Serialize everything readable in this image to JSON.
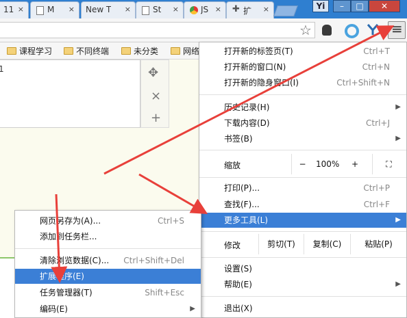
{
  "tabs": [
    {
      "title": "11",
      "close": "×"
    },
    {
      "title": "M",
      "close": "×"
    },
    {
      "title": "New T",
      "close": "×"
    },
    {
      "title": "St",
      "close": "×"
    },
    {
      "title": "JS",
      "close": "×"
    },
    {
      "title": "扩",
      "close": "×"
    }
  ],
  "window": {
    "user_badge": "Yi",
    "minimize": "–",
    "maximize": "□",
    "close": "✕"
  },
  "toolbar": {
    "star_icon": "☆",
    "menu_icon": "≡"
  },
  "bookmarks": [
    {
      "label": "课程学习"
    },
    {
      "label": "不同终端"
    },
    {
      "label": "未分类"
    },
    {
      "label": "网络"
    }
  ],
  "page": {
    "line_number": "1",
    "move_icon": "✥",
    "close_icon": "×",
    "add_icon": "+"
  },
  "main_menu": {
    "items": [
      {
        "label": "打开新的标签页(T)",
        "shortcut": "Ctrl+T"
      },
      {
        "label": "打开新的窗口(N)",
        "shortcut": "Ctrl+N"
      },
      {
        "label": "打开新的隐身窗口(I)",
        "shortcut": "Ctrl+Shift+N"
      },
      {
        "label": "历史记录(H)",
        "shortcut": "",
        "submenu": "▶"
      },
      {
        "label": "下载内容(D)",
        "shortcut": "Ctrl+J"
      },
      {
        "label": "书签(B)",
        "shortcut": "",
        "submenu": "▶"
      }
    ],
    "zoom": {
      "label": "缩放",
      "minus": "−",
      "value": "100%",
      "plus": "+",
      "fullscreen": "⛶"
    },
    "items2": [
      {
        "label": "打印(P)...",
        "shortcut": "Ctrl+P"
      },
      {
        "label": "查找(F)...",
        "shortcut": "Ctrl+F"
      },
      {
        "label": "更多工具(L)",
        "shortcut": "",
        "submenu": "▶"
      }
    ],
    "edit": {
      "label": "修改",
      "cut": "剪切(T)",
      "copy": "复制(C)",
      "paste": "粘贴(P)"
    },
    "items3": [
      {
        "label": "设置(S)",
        "shortcut": ""
      },
      {
        "label": "帮助(E)",
        "shortcut": "",
        "submenu": "▶"
      },
      {
        "label": "退出(X)",
        "shortcut": ""
      }
    ]
  },
  "sub_menu": {
    "items": [
      {
        "label": "网页另存为(A)...",
        "shortcut": "Ctrl+S"
      },
      {
        "label": "添加到任务栏...",
        "shortcut": ""
      },
      {
        "label": "清除浏览数据(C)...",
        "shortcut": "Ctrl+Shift+Del"
      },
      {
        "label": "扩展程序(E)",
        "shortcut": ""
      },
      {
        "label": "任务管理器(T)",
        "shortcut": "Shift+Esc"
      },
      {
        "label": "编码(E)",
        "shortcut": "",
        "submenu": "▶"
      }
    ]
  },
  "colors": {
    "accent": "#3b7fd6",
    "arrow": "#e8403a"
  }
}
